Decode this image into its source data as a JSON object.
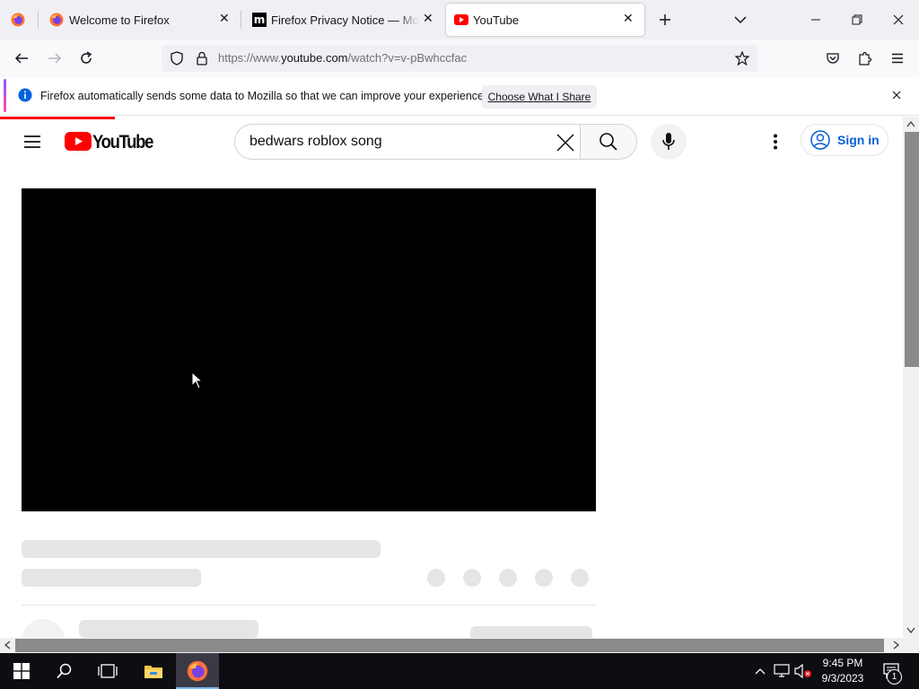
{
  "browser": {
    "tabs": [
      {
        "title": "Welcome to Firefox",
        "icon": "firefox-icon",
        "active": false
      },
      {
        "title": "Firefox Privacy Notice — Mozilla",
        "icon": "mozilla-m-icon",
        "active": false
      },
      {
        "title": "YouTube",
        "icon": "youtube-icon",
        "active": true
      }
    ],
    "url_prefix": "https://www.",
    "url_domain": "youtube.com",
    "url_path": "/watch?v=v-pBwhccfac"
  },
  "notification": {
    "message": "Firefox automatically sends some data to Mozilla so that we can improve your experience.",
    "button_label": "Choose What I Share"
  },
  "youtube": {
    "logo_text": "YouTube",
    "search_query": "bedwars roblox song",
    "signin_label": "Sign in"
  },
  "taskbar": {
    "time": "9:45 PM",
    "date": "9/3/2023",
    "notification_count": "1"
  },
  "colors": {
    "youtube_red": "#ff0000",
    "link_blue": "#065fd4",
    "firefox_accent": "#0060df"
  }
}
